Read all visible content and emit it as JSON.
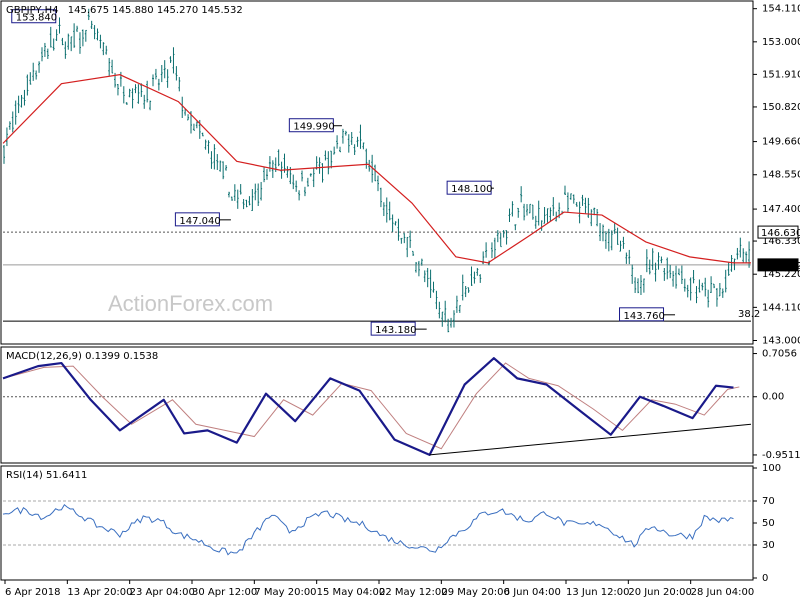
{
  "chart_data": [
    {
      "type": "candlestick",
      "panel": "price",
      "header": {
        "symbol_label": "GBPJPY,H4",
        "ohlc": "145.675 145.880 145.270 145.532"
      },
      "ylim": [
        142.95,
        154.3
      ],
      "yticks": [
        "154.110",
        "153.000",
        "151.910",
        "150.820",
        "149.660",
        "148.550",
        "147.400",
        "146.330",
        "145.220",
        "144.110",
        "143.000"
      ],
      "hlines": [
        {
          "value": 146.63,
          "label": "146.630",
          "style": "dashed"
        },
        {
          "value": 145.532,
          "label": "145.532",
          "style": "solid-gray"
        },
        {
          "value": 143.65,
          "label": "38.2",
          "style": "solid"
        }
      ],
      "annotations": [
        {
          "text": "153.840",
          "value": 153.84
        },
        {
          "text": "149.990",
          "value": 149.99
        },
        {
          "text": "147.040",
          "value": 147.04
        },
        {
          "text": "148.100",
          "value": 148.1
        },
        {
          "text": "143.180",
          "value": 143.18
        },
        {
          "text": "143.760",
          "value": 143.76
        }
      ],
      "series": [
        {
          "kind": "candles",
          "anchors": [
            [
              0,
              149.5
            ],
            [
              10,
              152.0
            ],
            [
              18,
              153.2
            ],
            [
              22,
              152.9
            ],
            [
              30,
              153.5
            ],
            [
              40,
              151.4
            ],
            [
              50,
              151.3
            ],
            [
              58,
              152.2
            ],
            [
              62,
              150.6
            ],
            [
              70,
              149.4
            ],
            [
              80,
              147.6
            ],
            [
              86,
              147.9
            ],
            [
              94,
              149.0
            ],
            [
              100,
              148.2
            ],
            [
              110,
              148.8
            ],
            [
              118,
              149.8
            ],
            [
              124,
              149.4
            ],
            [
              130,
              147.5
            ],
            [
              140,
              146.0
            ],
            [
              148,
              144.3
            ],
            [
              152,
              143.6
            ],
            [
              158,
              144.8
            ],
            [
              166,
              145.8
            ],
            [
              176,
              147.5
            ],
            [
              184,
              147.0
            ],
            [
              192,
              147.6
            ],
            [
              200,
              147.3
            ],
            [
              210,
              146.3
            ],
            [
              216,
              145.0
            ],
            [
              224,
              145.7
            ],
            [
              232,
              145.1
            ],
            [
              240,
              144.5
            ],
            [
              246,
              144.7
            ],
            [
              252,
              146.0
            ],
            [
              256,
              145.5
            ]
          ]
        },
        {
          "name": "",
          "kind": "ma",
          "values": [
            [
              0,
              149.6
            ],
            [
              20,
              151.6
            ],
            [
              40,
              151.9
            ],
            [
              60,
              151.0
            ],
            [
              80,
              149.0
            ],
            [
              95,
              148.7
            ],
            [
              110,
              148.8
            ],
            [
              125,
              148.9
            ],
            [
              140,
              147.6
            ],
            [
              155,
              145.8
            ],
            [
              166,
              145.6
            ],
            [
              180,
              146.5
            ],
            [
              192,
              147.3
            ],
            [
              205,
              147.2
            ],
            [
              220,
              146.3
            ],
            [
              235,
              145.8
            ],
            [
              250,
              145.6
            ],
            [
              256,
              145.6
            ]
          ]
        }
      ]
    },
    {
      "type": "line",
      "panel": "macd",
      "header": {
        "label": "MACD(12,26,9) 0.1399 0.1538"
      },
      "ylim": [
        -1.05,
        0.78
      ],
      "yticks": [
        "0.7056",
        "0.00",
        "-0.9511"
      ],
      "series": [
        {
          "name": "",
          "values": [
            [
              0,
              0.3
            ],
            [
              12,
              0.5
            ],
            [
              20,
              0.55
            ],
            [
              30,
              -0.05
            ],
            [
              40,
              -0.55
            ],
            [
              55,
              -0.05
            ],
            [
              62,
              -0.6
            ],
            [
              70,
              -0.55
            ],
            [
              80,
              -0.75
            ],
            [
              90,
              0.05
            ],
            [
              100,
              -0.4
            ],
            [
              112,
              0.3
            ],
            [
              122,
              0.1
            ],
            [
              134,
              -0.7
            ],
            [
              146,
              -0.95
            ],
            [
              158,
              0.2
            ],
            [
              168,
              0.63
            ],
            [
              176,
              0.3
            ],
            [
              186,
              0.2
            ],
            [
              198,
              -0.25
            ],
            [
              208,
              -0.62
            ],
            [
              218,
              0.0
            ],
            [
              226,
              -0.15
            ],
            [
              236,
              -0.35
            ],
            [
              244,
              0.18
            ],
            [
              250,
              0.15
            ]
          ]
        },
        {
          "name": "",
          "values": [
            [
              0,
              0.3
            ],
            [
              14,
              0.48
            ],
            [
              24,
              0.5
            ],
            [
              34,
              0.0
            ],
            [
              44,
              -0.45
            ],
            [
              58,
              -0.05
            ],
            [
              66,
              -0.45
            ],
            [
              76,
              -0.55
            ],
            [
              86,
              -0.65
            ],
            [
              96,
              -0.05
            ],
            [
              106,
              -0.3
            ],
            [
              116,
              0.22
            ],
            [
              126,
              0.1
            ],
            [
              138,
              -0.6
            ],
            [
              150,
              -0.85
            ],
            [
              162,
              0.05
            ],
            [
              172,
              0.55
            ],
            [
              180,
              0.3
            ],
            [
              190,
              0.18
            ],
            [
              202,
              -0.2
            ],
            [
              212,
              -0.55
            ],
            [
              222,
              -0.05
            ],
            [
              230,
              -0.12
            ],
            [
              240,
              -0.3
            ],
            [
              248,
              0.12
            ],
            [
              252,
              0.16
            ]
          ]
        }
      ],
      "trendline": [
        [
          146,
          -0.95
        ],
        [
          256,
          -0.45
        ]
      ]
    },
    {
      "type": "line",
      "panel": "rsi",
      "header": {
        "label": "RSI(14) 51.6411"
      },
      "ylim": [
        0,
        100
      ],
      "yticks": [
        "100",
        "70",
        "50",
        "30",
        "0"
      ],
      "levels": [
        70,
        30
      ],
      "series": [
        {
          "name": "",
          "values": [
            [
              0,
              60
            ],
            [
              8,
              62
            ],
            [
              14,
              55
            ],
            [
              20,
              65
            ],
            [
              26,
              58
            ],
            [
              32,
              48
            ],
            [
              40,
              40
            ],
            [
              48,
              55
            ],
            [
              54,
              52
            ],
            [
              60,
              40
            ],
            [
              66,
              35
            ],
            [
              74,
              25
            ],
            [
              80,
              22
            ],
            [
              86,
              40
            ],
            [
              92,
              58
            ],
            [
              98,
              42
            ],
            [
              104,
              52
            ],
            [
              110,
              60
            ],
            [
              118,
              52
            ],
            [
              124,
              48
            ],
            [
              130,
              38
            ],
            [
              136,
              32
            ],
            [
              142,
              28
            ],
            [
              148,
              25
            ],
            [
              152,
              35
            ],
            [
              158,
              45
            ],
            [
              164,
              58
            ],
            [
              170,
              62
            ],
            [
              176,
              55
            ],
            [
              180,
              52
            ],
            [
              186,
              60
            ],
            [
              192,
              50
            ],
            [
              198,
              48
            ],
            [
              204,
              50
            ],
            [
              210,
              40
            ],
            [
              216,
              30
            ],
            [
              222,
              48
            ],
            [
              228,
              40
            ],
            [
              236,
              38
            ],
            [
              240,
              55
            ],
            [
              246,
              52
            ],
            [
              250,
              54
            ]
          ]
        }
      ]
    }
  ],
  "x_axis": {
    "tick_labels": [
      "6 Apr 2018",
      "13 Apr 20:00",
      "23 Apr 04:00",
      "30 Apr 12:00",
      "7 May 20:00",
      "15 May 04:00",
      "22 May 12:00",
      "29 May 20:00",
      "6 Jun 04:00",
      "13 Jun 12:00",
      "20 Jun 20:00",
      "28 Jun 04:00"
    ]
  },
  "watermark": "ActionForex.com",
  "colors": {
    "candle": "#0a6e6e",
    "ma": "#d42020",
    "macd": "#1a1a8a",
    "signal": "#c08080",
    "rsi": "#3a6fc0",
    "label_border": "#1a1a8a",
    "grid_dash": "#555555"
  }
}
